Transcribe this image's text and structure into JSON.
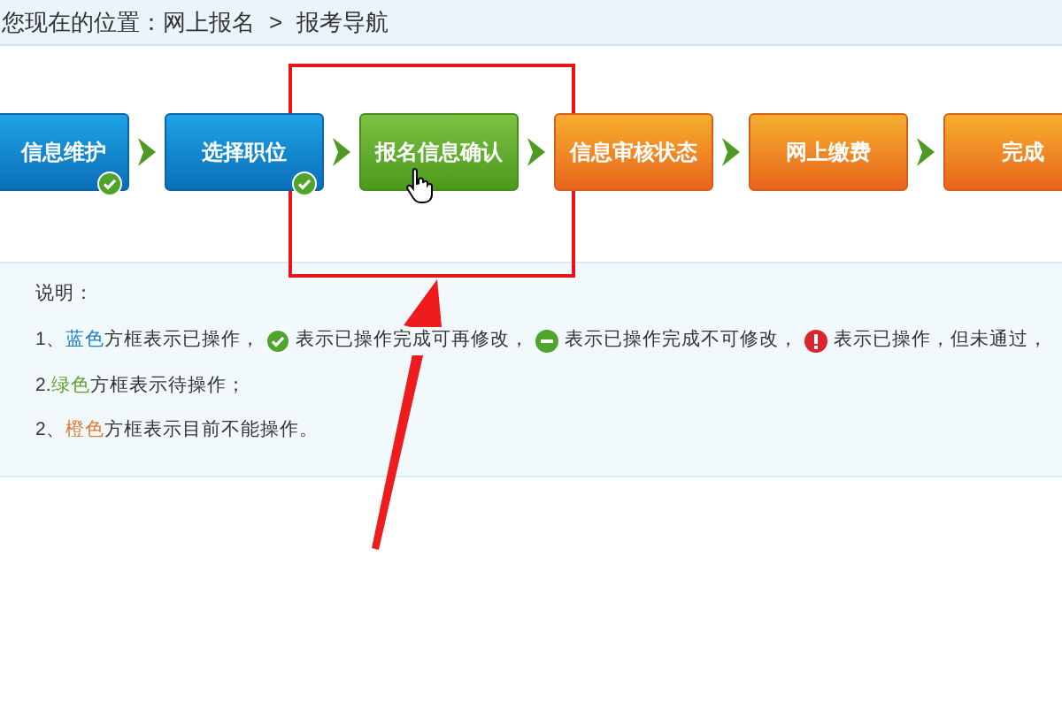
{
  "breadcrumb": {
    "label": "您现在的位置：网上报名",
    "separator": ">",
    "current": "报考导航"
  },
  "steps": [
    {
      "label": "信息维护",
      "kind": "done",
      "checked": true
    },
    {
      "label": "选择职位",
      "kind": "done",
      "checked": true
    },
    {
      "label": "报名信息确认",
      "kind": "pending",
      "checked": false
    },
    {
      "label": "信息审核状态",
      "kind": "locked",
      "checked": false
    },
    {
      "label": "网上缴费",
      "kind": "locked",
      "checked": false
    },
    {
      "label": "完成",
      "kind": "locked",
      "checked": false
    }
  ],
  "notes": {
    "title": "说明：",
    "lines": [
      {
        "segments": [
          {
            "kind": "text",
            "text": "1、"
          },
          {
            "kind": "colored",
            "text": "蓝色",
            "color": "#1a7ec8"
          },
          {
            "kind": "text",
            "text": "方框表示已操作，"
          },
          {
            "kind": "check"
          },
          {
            "kind": "text",
            "text": "表示已操作完成可再修改，"
          },
          {
            "kind": "minus"
          },
          {
            "kind": "text",
            "text": "表示已操作完成不可修改，"
          },
          {
            "kind": "error"
          },
          {
            "kind": "text",
            "text": "表示已操作，但未通过，"
          }
        ]
      },
      {
        "segments": [
          {
            "kind": "text",
            "text": "2. "
          },
          {
            "kind": "colored",
            "text": "绿色",
            "color": "#5aa02c"
          },
          {
            "kind": "text",
            "text": "方框表示待操作；"
          }
        ]
      },
      {
        "segments": [
          {
            "kind": "text",
            "text": "2、"
          },
          {
            "kind": "colored",
            "text": "橙色",
            "color": "#e07a2c"
          },
          {
            "kind": "text",
            "text": "方框表示目前不能操作。"
          }
        ]
      }
    ]
  }
}
